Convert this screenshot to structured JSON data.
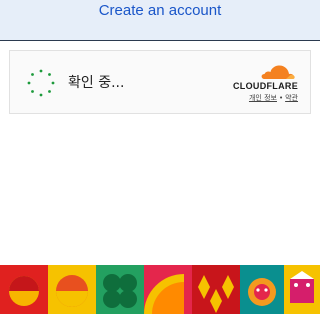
{
  "header": {
    "create_account_link": "Create an account"
  },
  "challenge": {
    "status_text": "확인 중...",
    "provider_name": "CLOUDFLARE",
    "privacy_link": "개인 정보",
    "separator": "•",
    "terms_link": "약관"
  },
  "icons": {
    "spinner": "loading-spinner-icon",
    "logo": "cloudflare-cloud-icon"
  },
  "colors": {
    "link": "#1a56c9",
    "spinner": "#1d9a3c",
    "cloudflare_orange": "#f48120",
    "topbar_bg": "#e6eef9"
  }
}
